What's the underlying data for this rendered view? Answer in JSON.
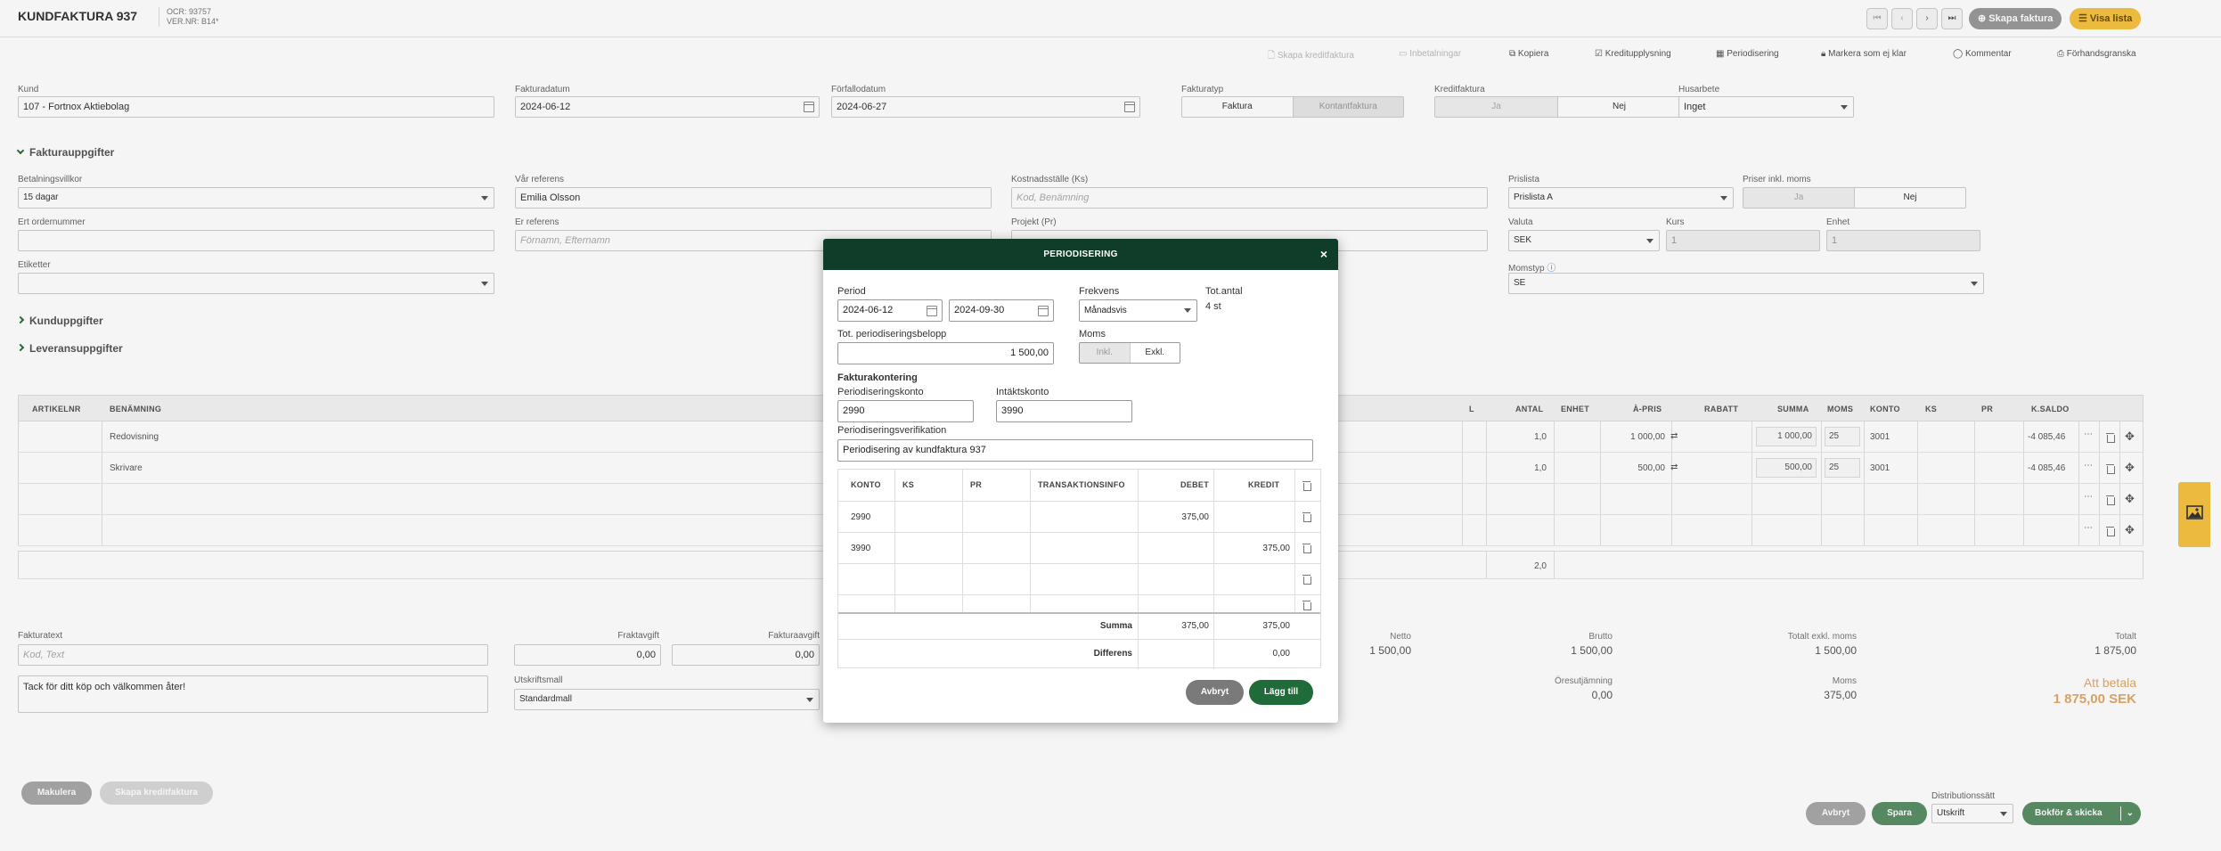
{
  "header": {
    "title": "KUNDFAKTURA 937",
    "ocr": "OCR: 93757",
    "ver": "VER.NR: B14*",
    "nav": [
      "⏮",
      "‹",
      "›",
      "⏭"
    ],
    "create_invoice": "Skapa faktura",
    "show_list": "Visa lista"
  },
  "actions": {
    "create_credit": "Skapa kreditfaktura",
    "payments": "Inbetalningar",
    "copy": "Kopiera",
    "credit_info": "Kreditupplysning",
    "periodization": "Periodisering",
    "mark_unclear": "Markera som ej klar",
    "comment": "Kommentar",
    "preview": "Förhandsgranska"
  },
  "form": {
    "customer_label": "Kund",
    "customer_value": "107 - Fortnox Aktiebolag",
    "invoice_date_label": "Fakturadatum",
    "invoice_date_value": "2024-06-12",
    "due_date_label": "Förfallodatum",
    "due_date_value": "2024-06-27",
    "invoice_type_label": "Fakturatyp",
    "invoice_type_options": [
      "Faktura",
      "Kontantfaktura"
    ],
    "credit_label": "Kreditfaktura",
    "credit_options": [
      "Ja",
      "Nej"
    ],
    "house_label": "Husarbete",
    "house_value": "Inget",
    "section_invoice": "Fakturauppgifter",
    "payment_terms_label": "Betalningsvillkor",
    "payment_terms_value": "15 dagar",
    "our_ref_label": "Vår referens",
    "our_ref_value": "Emilia Olsson",
    "cost_center_label": "Kostnadsställe (Ks)",
    "cost_center_placeholder": "Kod, Benämning",
    "pricelist_label": "Prislista",
    "pricelist_value": "Prislista A",
    "prices_incl_label": "Priser inkl. moms",
    "prices_incl_options": [
      "Ja",
      "Nej"
    ],
    "order_no_label": "Ert ordernummer",
    "your_ref_label": "Er referens",
    "your_ref_placeholder": "Förnamn, Efternamn",
    "project_label": "Projekt (Pr)",
    "currency_label": "Valuta",
    "currency_value": "SEK",
    "rate_label": "Kurs",
    "rate_value": "1",
    "unit_label": "Enhet",
    "unit_value": "1",
    "labels_label": "Etiketter",
    "vat_type_label": "Momstyp",
    "vat_type_value": "SE",
    "section_customer": "Kunduppgifter",
    "section_delivery": "Leveransuppgifter"
  },
  "table": {
    "columns": [
      "ARTIKELNR",
      "BENÄMNING",
      "L",
      "ANTAL",
      "ENHET",
      "À-PRIS",
      "RABATT",
      "SUMMA",
      "MOMS",
      "KONTO",
      "KS",
      "PR",
      "K.SALDO"
    ],
    "rows": [
      {
        "name": "Redovisning",
        "qty": "1,0",
        "price": "1 000,00",
        "sum": "1 000,00",
        "vat": "25",
        "account": "3001",
        "balance": "-4 085,46"
      },
      {
        "name": "Skrivare",
        "qty": "1,0",
        "price": "500,00",
        "sum": "500,00",
        "vat": "25",
        "account": "3001",
        "balance": "-4 085,46"
      }
    ],
    "total_qty": "2,0"
  },
  "footer": {
    "invoice_text_label": "Fakturatext",
    "invoice_text_placeholder": "Kod, Text",
    "freight_label": "Fraktavgift",
    "freight_value": "0,00",
    "fee_label": "Fakturaavgift",
    "fee_value": "0,00",
    "message": "Tack för ditt köp och välkommen åter!",
    "print_template_label": "Utskriftsmall",
    "print_template_value": "Standardmall",
    "net_label": "Netto",
    "net_value": "1 500,00",
    "gross_label": "Brutto",
    "gross_value": "1 500,00",
    "total_excl_label": "Totalt exkl. moms",
    "total_excl_value": "1 500,00",
    "total_label": "Totalt",
    "total_value": "1 875,00",
    "rounding_label": "Öresutjämning",
    "rounding_value": "0,00",
    "vat_label": "Moms",
    "vat_value": "375,00",
    "to_pay_label": "Att betala",
    "to_pay_value": "1 875,00 SEK",
    "void": "Makulera",
    "create_credit": "Skapa kreditfaktura",
    "cancel": "Avbryt",
    "save": "Spara",
    "distribution_label": "Distributionssätt",
    "distribution_value": "Utskrift",
    "book_send": "Bokför & skicka"
  },
  "modal": {
    "title": "PERIODISERING",
    "period_label": "Period",
    "period_from": "2024-06-12",
    "period_to": "2024-09-30",
    "frequency_label": "Frekvens",
    "frequency_value": "Månadsvis",
    "tot_count_label": "Tot.antal",
    "tot_count_value": "4 st",
    "tot_amount_label": "Tot. periodiseringsbelopp",
    "tot_amount_value": "1 500,00",
    "vat_label": "Moms",
    "vat_options": [
      "Inkl.",
      "Exkl."
    ],
    "accounting_heading": "Fakturakontering",
    "period_account_label": "Periodiseringskonto",
    "period_account_value": "2990",
    "income_account_label": "Intäktskonto",
    "income_account_value": "3990",
    "verification_label": "Periodiseringsverifikation",
    "verification_value": "Periodisering av kundfaktura 937",
    "columns": [
      "KONTO",
      "KS",
      "PR",
      "TRANSAKTIONSINFO",
      "DEBET",
      "KREDIT"
    ],
    "rows": [
      {
        "account": "2990",
        "debit": "375,00",
        "credit": ""
      },
      {
        "account": "3990",
        "debit": "",
        "credit": "375,00"
      }
    ],
    "sum_label": "Summa",
    "sum_debit": "375,00",
    "sum_credit": "375,00",
    "diff_label": "Differens",
    "diff_value": "0,00",
    "cancel": "Avbryt",
    "add": "Lägg till"
  },
  "colors": {
    "modal_header": "#0f3d2a",
    "primary_green": "#1f6b3a",
    "accent_yellow": "#f5c242",
    "to_pay": "#e0a866"
  }
}
